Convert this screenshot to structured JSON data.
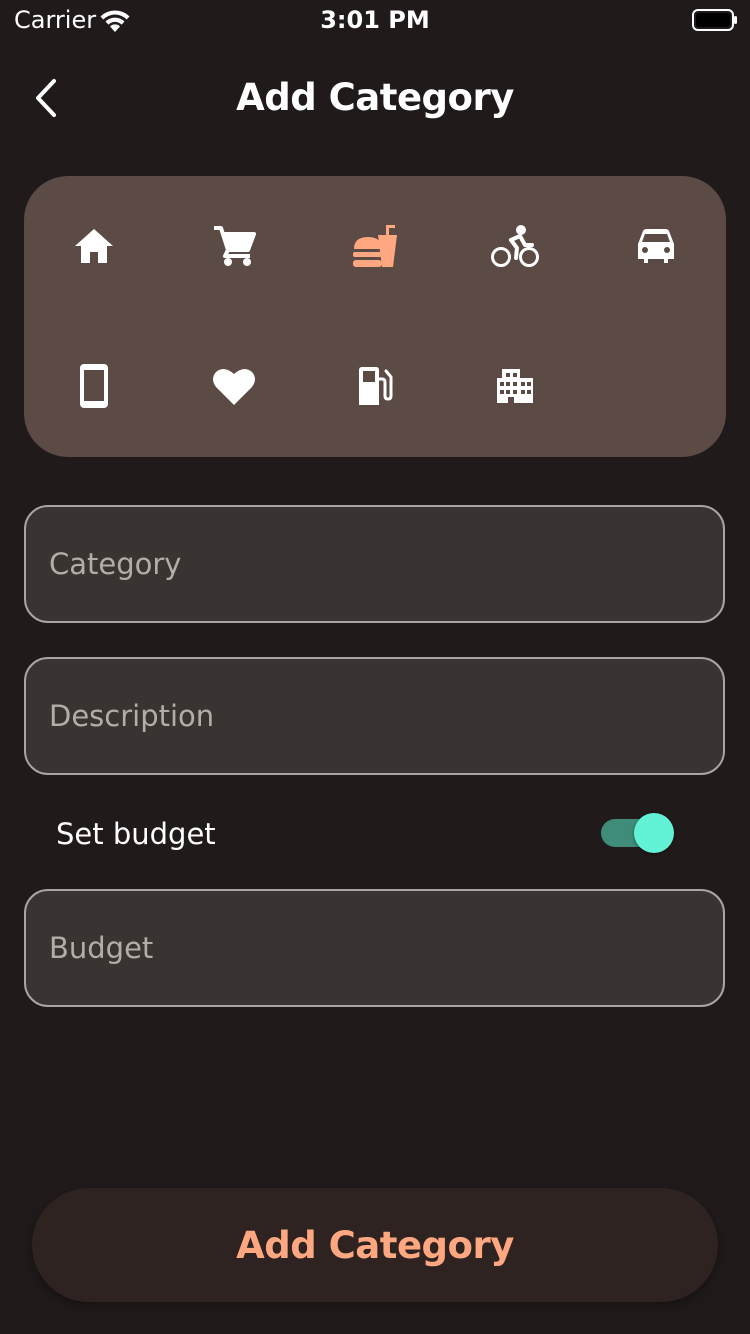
{
  "status_bar": {
    "carrier": "Carrier",
    "time": "3:01 PM"
  },
  "header": {
    "title": "Add Category",
    "back_icon": "chevron-left-icon"
  },
  "icon_picker": {
    "selected": "fastfood",
    "selected_color": "#ffa780",
    "default_color": "#ffffff",
    "icons": [
      "home",
      "shopping-cart",
      "fastfood",
      "bicycle",
      "car",
      "smartphone",
      "heart",
      "fuel-station",
      "building"
    ]
  },
  "form": {
    "category_placeholder": "Category",
    "category_value": "",
    "description_placeholder": "Description",
    "description_value": "",
    "set_budget_label": "Set budget",
    "set_budget_enabled": true,
    "budget_placeholder": "Budget",
    "budget_value": ""
  },
  "colors": {
    "background": "#201b1a",
    "panel": "#5c4a44",
    "field": "#393331",
    "accent": "#ffa780",
    "toggle_on": "#62f3d6"
  },
  "submit_label": "Add Category"
}
